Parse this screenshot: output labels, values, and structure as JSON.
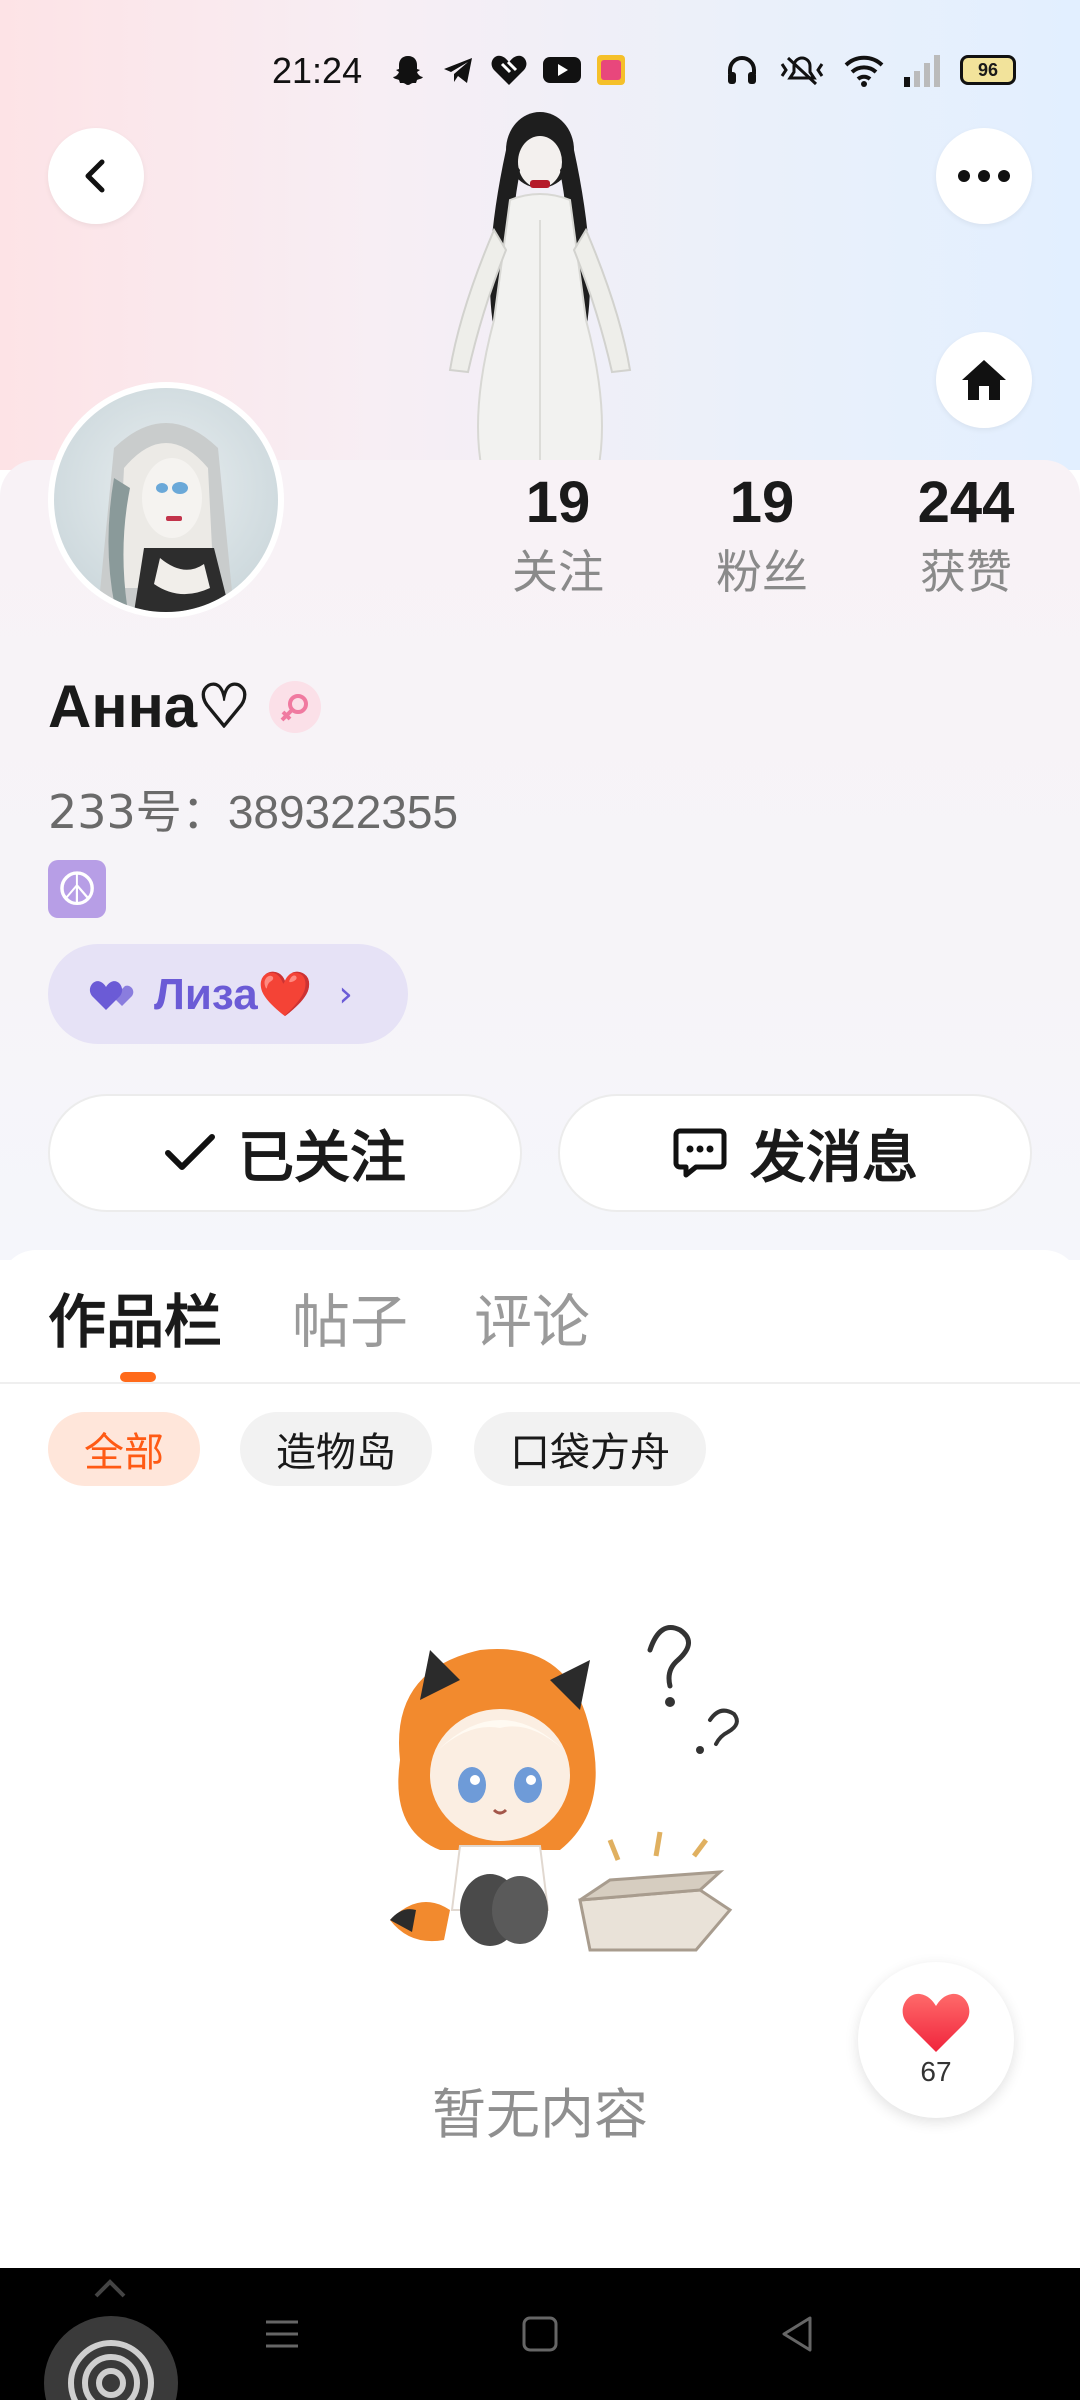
{
  "status_bar": {
    "time": "21:24",
    "battery": "96",
    "app_icons": [
      "snapchat-icon",
      "telegram-icon",
      "heart-app-icon",
      "youtube-icon",
      "app-icon"
    ],
    "system_icons": [
      "headphones-icon",
      "mute-icon",
      "wifi-icon",
      "signal-icon"
    ]
  },
  "header": {
    "back_icon": "chevron-left-icon",
    "more_icon": "more-dots-icon",
    "home_icon": "home-icon"
  },
  "profile": {
    "stats": [
      {
        "value": "19",
        "label": "关注"
      },
      {
        "value": "19",
        "label": "粉丝"
      },
      {
        "value": "244",
        "label": "获赞"
      }
    ],
    "name": "Анна♡",
    "id_label": "233号：",
    "id_number": "389322355",
    "bio_icon": "☮",
    "cp_name": "Лиза❤️",
    "cp_icon": "hearts-icon",
    "follow_label": "已关注",
    "message_label": "发消息"
  },
  "tabs": [
    {
      "label": "作品栏",
      "active": true
    },
    {
      "label": "帖子",
      "active": false
    },
    {
      "label": "评论",
      "active": false
    }
  ],
  "filters": [
    {
      "label": "全部",
      "active": true
    },
    {
      "label": "造物岛",
      "active": false
    },
    {
      "label": "口袋方舟",
      "active": false
    }
  ],
  "empty_state": {
    "text": "暂无内容"
  },
  "like_fab": {
    "count": "67"
  },
  "colors": {
    "accent": "#ff6a1a",
    "cp_purple": "#6b5bd6",
    "heart_red": "#ff3b4d"
  }
}
